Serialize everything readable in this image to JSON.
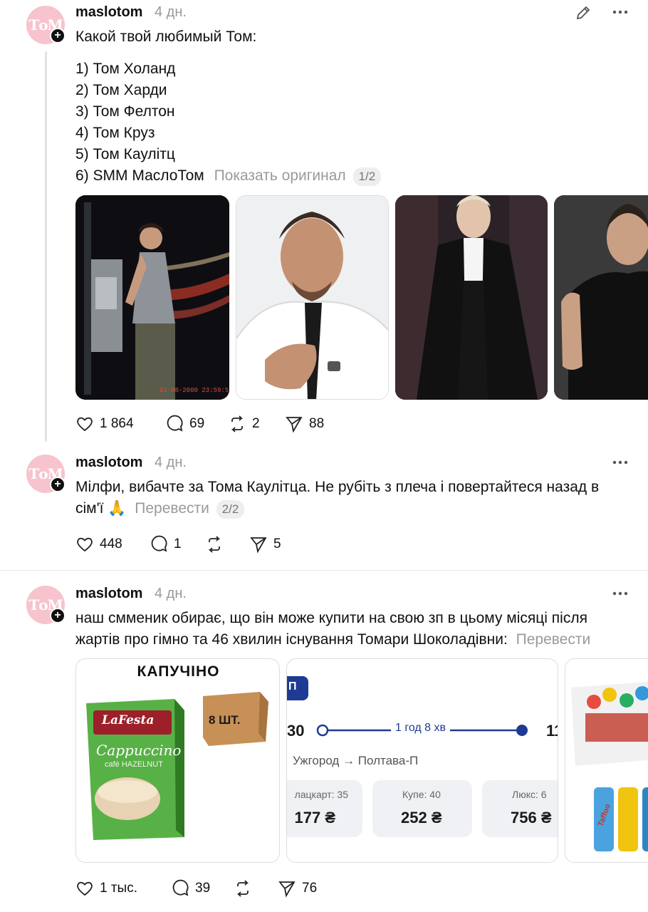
{
  "posts": [
    {
      "username": "maslotom",
      "time": "4 дн.",
      "avatar_text": "ТоМ",
      "lines": [
        "Какой твой любимый Том:",
        "1) Том Холанд",
        "2) Том Харди",
        "3) Том Фелтон",
        "4) Том Круз",
        "5) Том Каулітц",
        "6) SMM МаслоТом"
      ],
      "show_original": "Показать оригинал",
      "page_badge": "1/2",
      "photos": [
        "tom-holland-photo",
        "tom-hardy-photo",
        "tom-felton-photo",
        "tom-cruise-photo"
      ],
      "photo_caption": "01-08-2000 23:59:59",
      "likes": "1 864",
      "comments": "69",
      "reposts": "2",
      "shares": "88"
    },
    {
      "username": "maslotom",
      "time": "4 дн.",
      "avatar_text": "ТоМ",
      "line1": "Мілфи, вибачте за Тома Каулітца. Не рубіть з плеча і повертайтеся назад в",
      "line2": "сім'ї 🙏",
      "translate": "Перевести",
      "page_badge": "2/2",
      "likes": "448",
      "comments": "1",
      "reposts": "",
      "shares": "5"
    },
    {
      "username": "maslotom",
      "time": "4 дн.",
      "avatar_text": "ТоМ",
      "line1": "наш смменик обирає, що він може купити на свою зп в цьому місяці після",
      "line2": "жартів про гімно та 46 хвилин існування Томари Шоколадівни:",
      "translate": "Перевести",
      "card1": {
        "heading": "КАПУЧІНО",
        "box_label": "8 ШТ.",
        "brand": "LaFesta",
        "product": "Cappuccino",
        "flavor": "café HAZELNUT"
      },
      "card2": {
        "tag": "П",
        "depart": "30",
        "duration": "1 год 8 хв",
        "arrive": "11",
        "route": "Ужгород → Полтава-П",
        "fares": [
          {
            "label": "лацкарт: 35",
            "price": "177 ₴"
          },
          {
            "label": "Купе: 40",
            "price": "252 ₴"
          },
          {
            "label": "Люкс: 6",
            "price": "756 ₴"
          }
        ]
      },
      "card3": {
        "bottle_label": "Taffoo"
      },
      "likes": "1 тыс.",
      "comments": "39",
      "reposts": "",
      "shares": "76"
    }
  ],
  "colors": {
    "avatar_bg": "#f7c3cc",
    "muted": "#9a9a9a",
    "train_blue": "#1f3a93",
    "lafesta_green": "#3e9a2c"
  }
}
